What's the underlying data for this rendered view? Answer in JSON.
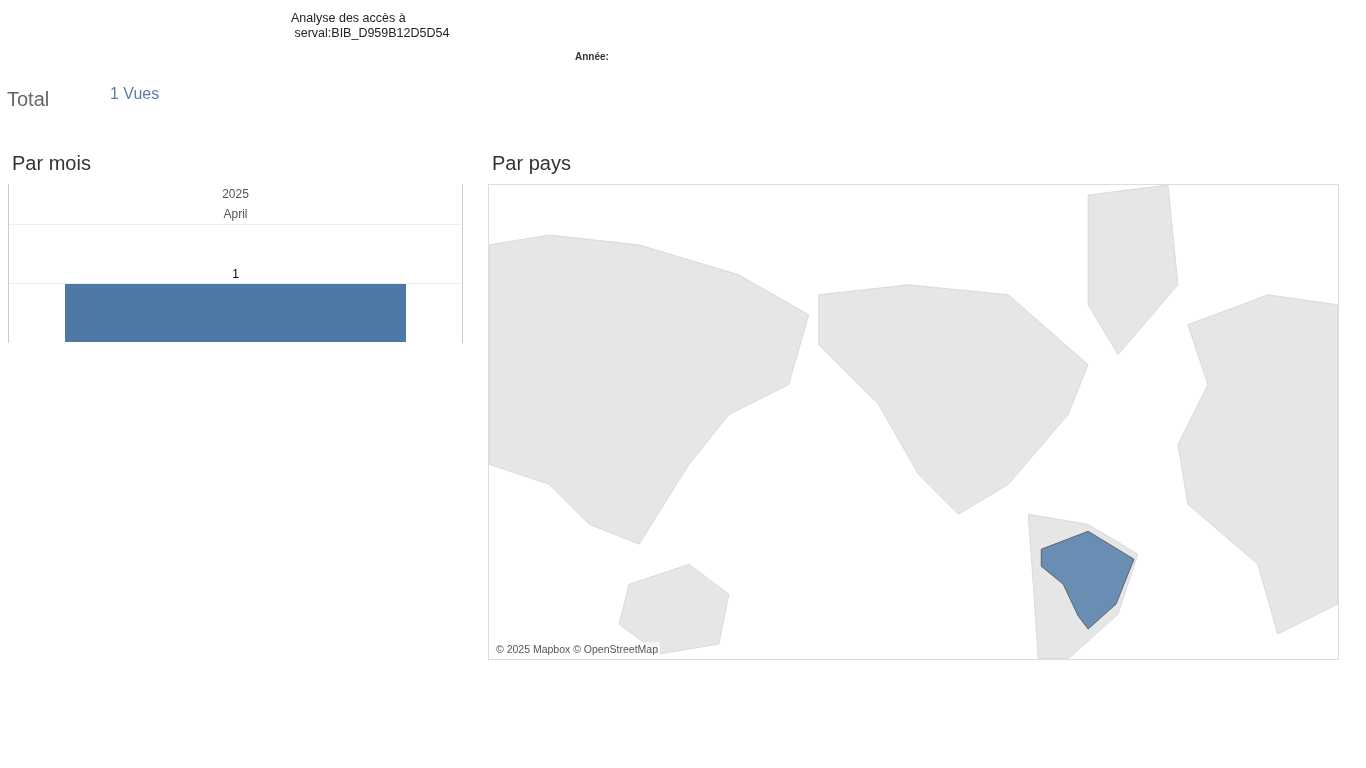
{
  "header": {
    "title": "Analyse des accès à\n serval:BIB_D959B12D5D54",
    "filter_label": "Année:"
  },
  "total": {
    "label": "Total",
    "value": "1 Vues"
  },
  "by_month": {
    "heading": "Par mois",
    "year": "2025",
    "month": "April",
    "value_label": "1"
  },
  "by_country": {
    "heading": "Par pays",
    "attribution": "© 2025 Mapbox © OpenStreetMap"
  }
}
